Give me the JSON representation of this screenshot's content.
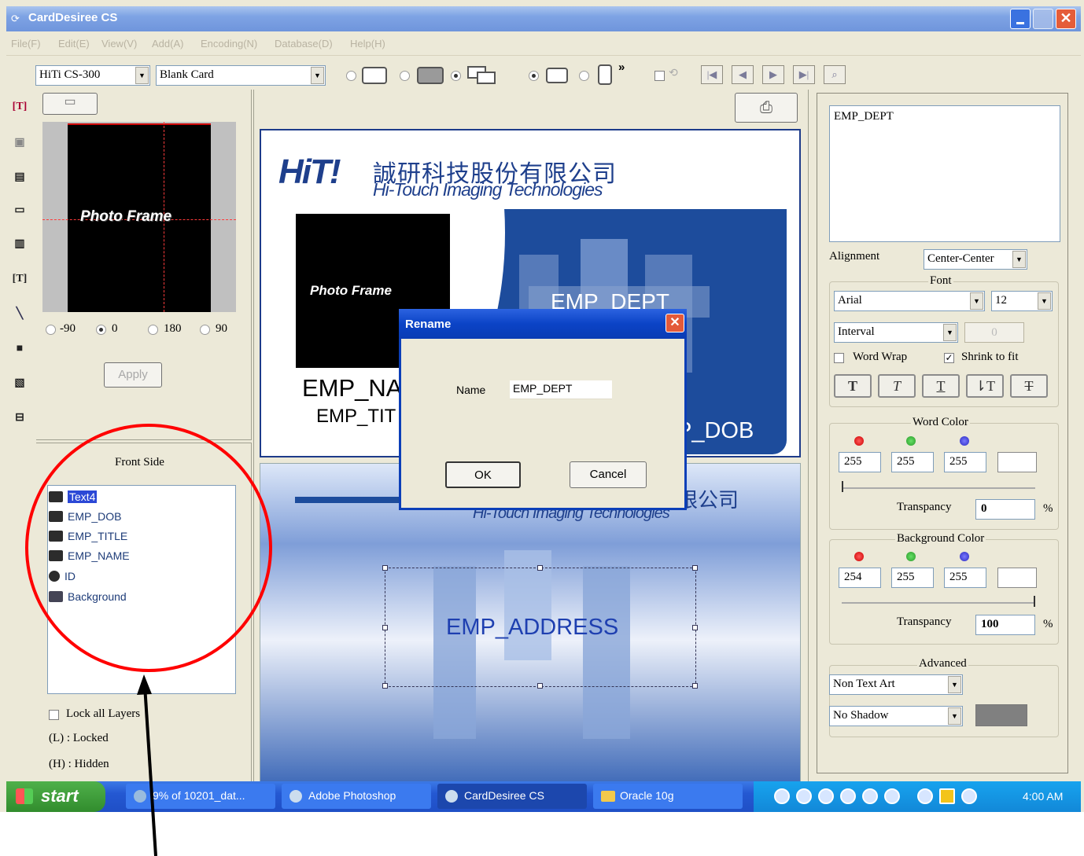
{
  "window": {
    "title": "CardDesiree CS"
  },
  "menu": [
    "File(F)",
    "Edit(E)",
    "View(V)",
    "Add(A)",
    "Encoding(N)",
    "Database(D)",
    "Help(H)"
  ],
  "toolbar": {
    "printer": "HiTi CS-300",
    "template": "Blank Card"
  },
  "photo_panel": {
    "preview_label": "Photo Frame",
    "rotations": [
      "-90",
      "0",
      "180",
      "90"
    ],
    "selected_rotation": "0",
    "apply": "Apply"
  },
  "layers": {
    "title": "Front Side",
    "items": [
      "Text4",
      "EMP_DOB",
      "EMP_TITLE",
      "EMP_NAME",
      "ID",
      "Background"
    ],
    "lock_all": "Lock all Layers",
    "locked_hint": "(L) : Locked",
    "hidden_hint": "(H) : Hidden"
  },
  "card_front": {
    "company_cn": "誠研科技股份有限公司",
    "company_en": "Hi-Touch Imaging Technologies",
    "logo": "HiT!",
    "photo_label": "Photo Frame",
    "dept": "EMP_DEPT",
    "name": "EMP_NA",
    "title": "EMP_TIT",
    "dob": "P_DOB"
  },
  "card_back": {
    "company_cn": "限公司",
    "company_en": "Hi-Touch Imaging Technologies",
    "address": "EMP_ADDRESS"
  },
  "dialog": {
    "title": "Rename",
    "name_label": "Name",
    "name_value": "EMP_DEPT",
    "ok": "OK",
    "cancel": "Cancel"
  },
  "properties": {
    "text_value": "EMP_DEPT",
    "alignment_label": "Alignment",
    "alignment": "Center-Center",
    "font_title": "Font",
    "font_name": "Arial",
    "font_size": "12",
    "spacing": "Interval",
    "spacing_value": "0",
    "word_wrap": "Word Wrap",
    "shrink_to_fit": "Shrink to fit",
    "word_color_title": "Word Color",
    "word_color": {
      "r": "255",
      "g": "255",
      "b": "255"
    },
    "word_transparency_label": "Transpancy",
    "word_transparency": "0",
    "background_color_title": "Background Color",
    "background_color": {
      "r": "254",
      "g": "255",
      "b": "255"
    },
    "bg_transparency_label": "Transpancy",
    "bg_transparency": "100",
    "percent": "%",
    "advanced_title": "Advanced",
    "text_art": "Non Text Art",
    "shadow": "No Shadow"
  },
  "taskbar": {
    "start": "start",
    "tasks": [
      "9% of 10201_dat...",
      "Adobe Photoshop",
      "CardDesiree CS",
      "Oracle 10g"
    ],
    "clock": "4:00 AM"
  },
  "colors": {
    "title_bar": "#7ea3e4",
    "taskbar": "#2458d2",
    "annotation": "#ff0000",
    "card_blue": "#1d4c9c"
  }
}
